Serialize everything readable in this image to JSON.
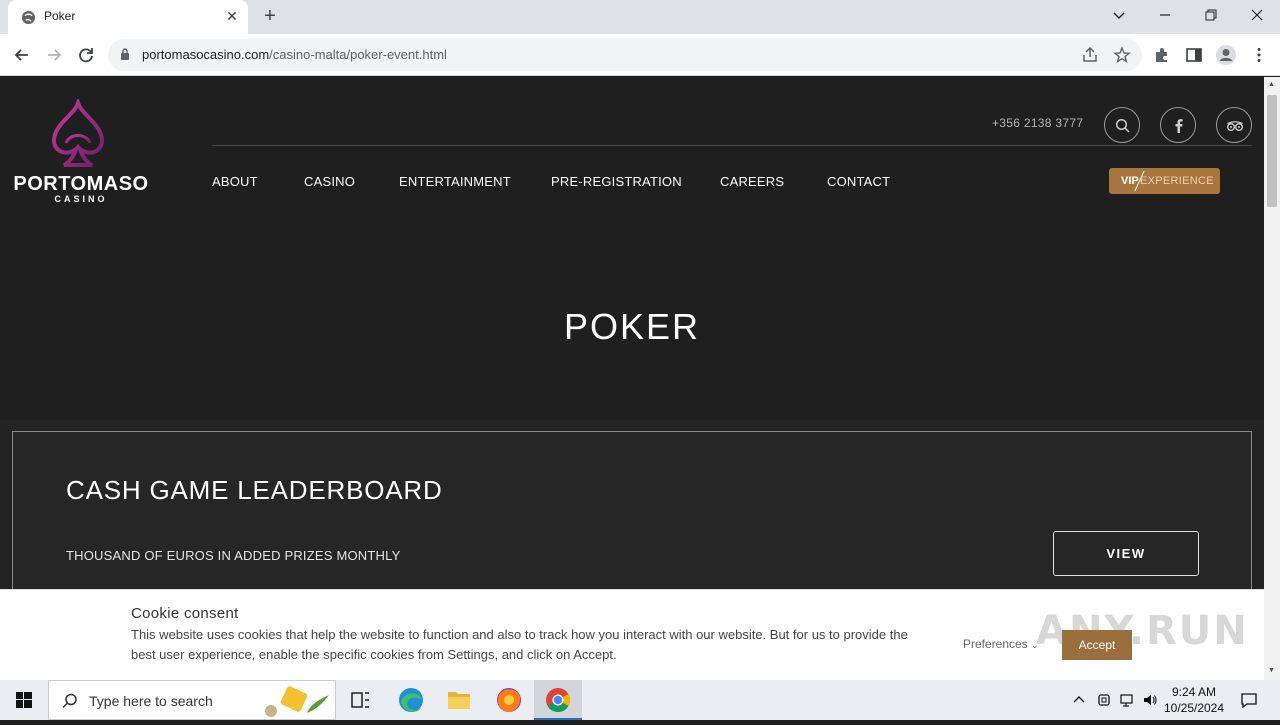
{
  "browser": {
    "tab_title": "Poker",
    "url_domain": "portomasocasino.com",
    "url_path": "/casino-malta/poker-event.html"
  },
  "header": {
    "logo_text": "PORTOMASO",
    "logo_sub": "CASINO",
    "phone": "+356 2138 3777",
    "nav": [
      "ABOUT",
      "CASINO",
      "ENTERTAINMENT",
      "PRE-REGISTRATION",
      "CAREERS",
      "CONTACT"
    ],
    "vip_label": "VIP",
    "vip_experience": "EXPERIENCE"
  },
  "hero": {
    "title": "POKER"
  },
  "card": {
    "title": "CASH GAME LEADERBOARD",
    "subtitle": "THOUSAND OF EUROS IN ADDED PRIZES MONTHLY",
    "button": "VIEW"
  },
  "cookie": {
    "title": "Cookie consent",
    "text": "This website uses cookies that help the website to function and also to track how you interact with our website. But for us to provide the best user experience, enable the specific cookies from Settings, and click on Accept.",
    "preferences": "Preferences",
    "accept": "Accept",
    "watermark": "ANY.RUN"
  },
  "taskbar": {
    "search_placeholder": "Type here to search",
    "time": "9:24 AM",
    "date": "10/25/2024"
  },
  "colors": {
    "accent_gold": "#a8763e",
    "logo_magenta": "#9b2a7f",
    "page_bg": "#1f1f1f"
  }
}
